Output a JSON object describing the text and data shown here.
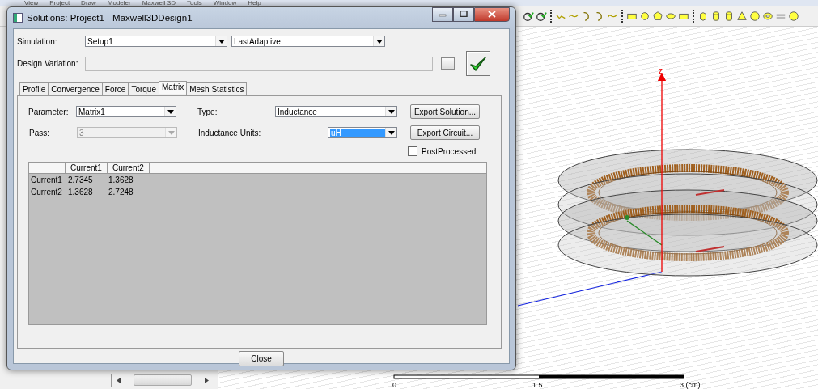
{
  "menu_bar": [
    "View",
    "Project",
    "Draw",
    "Modeler",
    "Maxwell 3D",
    "Tools",
    "Window",
    "Help"
  ],
  "dialog": {
    "title": "Solutions: Project1 - Maxwell3DDesign1",
    "simulation": {
      "label": "Simulation:",
      "setup": "Setup1",
      "solution": "LastAdaptive"
    },
    "design_variation": {
      "label": "Design Variation:",
      "browse_button": "..."
    },
    "tabs": [
      {
        "label": "Profile",
        "selected": false
      },
      {
        "label": "Convergence",
        "selected": false
      },
      {
        "label": "Force",
        "selected": false
      },
      {
        "label": "Torque",
        "selected": false
      },
      {
        "label": "Matrix",
        "selected": true
      },
      {
        "label": "Mesh Statistics",
        "selected": false
      }
    ],
    "parameter": {
      "label": "Parameter:",
      "value": "Matrix1"
    },
    "pass": {
      "label": "Pass:",
      "value": "3",
      "disabled": true
    },
    "type": {
      "label": "Type:",
      "value": "Inductance"
    },
    "units": {
      "label": "Inductance Units:",
      "value": "uH",
      "selected": true
    },
    "buttons": [
      "Export Solution...",
      "Export Circuit..."
    ],
    "post_processed": {
      "label": "PostProcessed",
      "checked": false
    },
    "matrix": {
      "columns": [
        "Current1",
        "Current2"
      ],
      "rows": [
        {
          "label": "Current1",
          "cells": [
            "2.7345",
            "1.3628"
          ]
        },
        {
          "label": "Current2",
          "cells": [
            "1.3628",
            "2.7248"
          ]
        }
      ]
    },
    "close_button": "Close"
  },
  "viewport": {
    "axis_label": "z",
    "scale_labels": [
      "0",
      "1.5",
      "3 (cm)"
    ]
  }
}
